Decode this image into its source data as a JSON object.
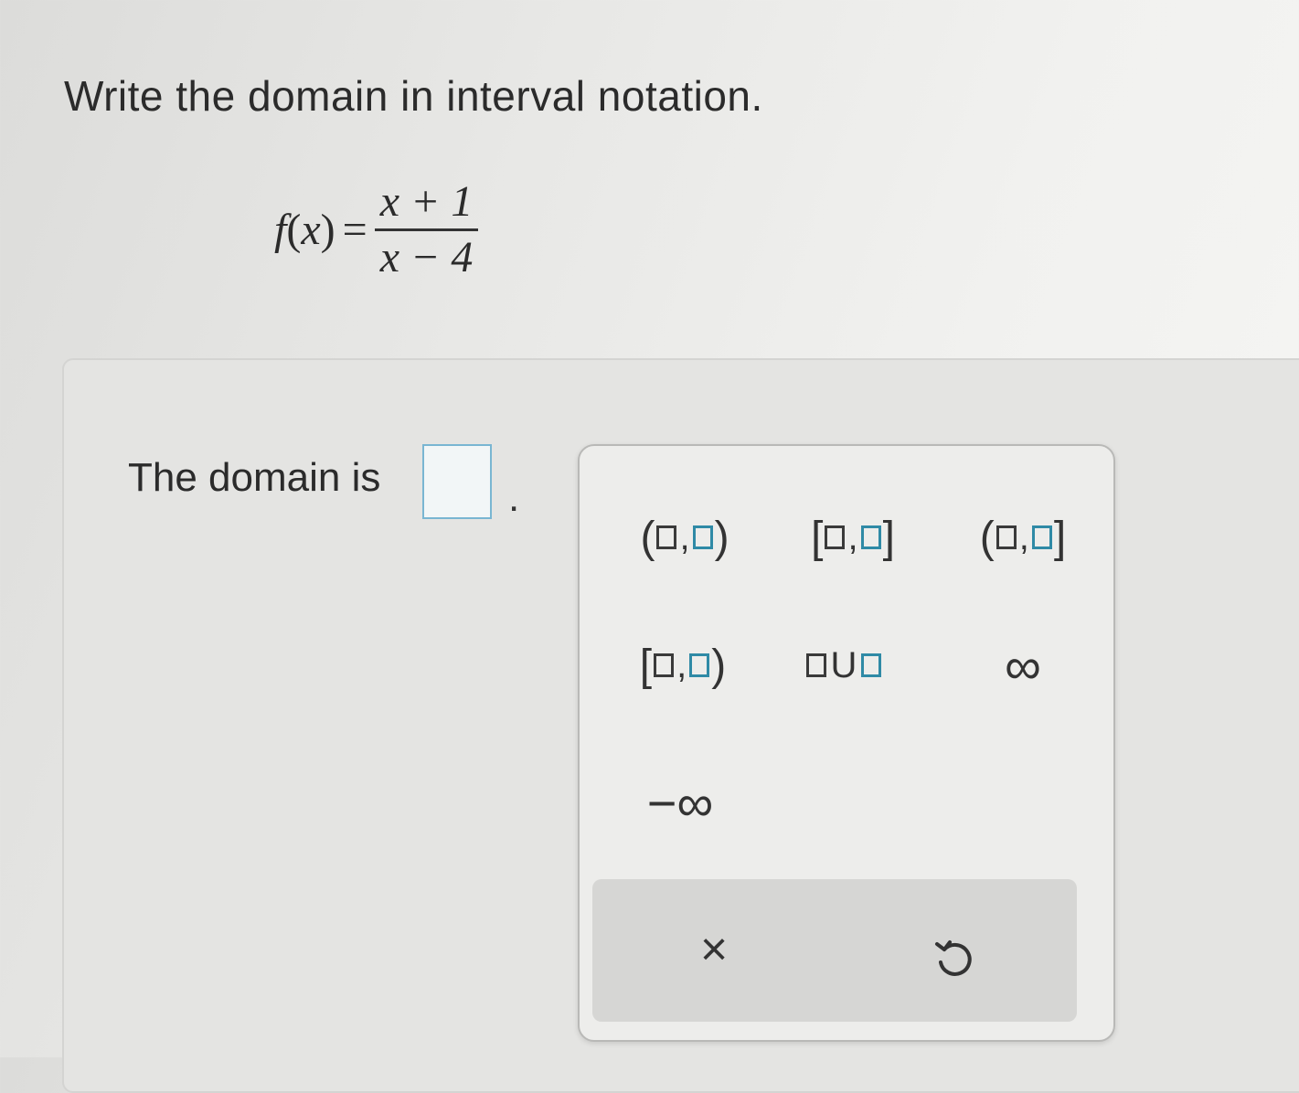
{
  "question": "Write the domain in interval notation.",
  "formula": {
    "lhs_func": "f",
    "lhs_open": "(",
    "lhs_var": "x",
    "lhs_close": ")",
    "equals": "=",
    "numerator": "x + 1",
    "denominator": "x − 4"
  },
  "answer": {
    "prompt": "The domain is",
    "value": "",
    "period": "."
  },
  "palette": {
    "buttons": [
      {
        "left": "(",
        "sep": ",",
        "right": ")"
      },
      {
        "left": "[",
        "sep": ",",
        "right": "]"
      },
      {
        "left": "(",
        "sep": ",",
        "right": "]"
      },
      {
        "left": "[",
        "sep": ",",
        "right": ")"
      }
    ],
    "union_symbol": "U",
    "infinity": "∞",
    "neg_infinity": "−∞",
    "clear_symbol": "×",
    "undo_icon": "undo-icon"
  },
  "colors": {
    "answer_box_border": "#79b6d2",
    "teal_box": "#2f8aa6"
  }
}
